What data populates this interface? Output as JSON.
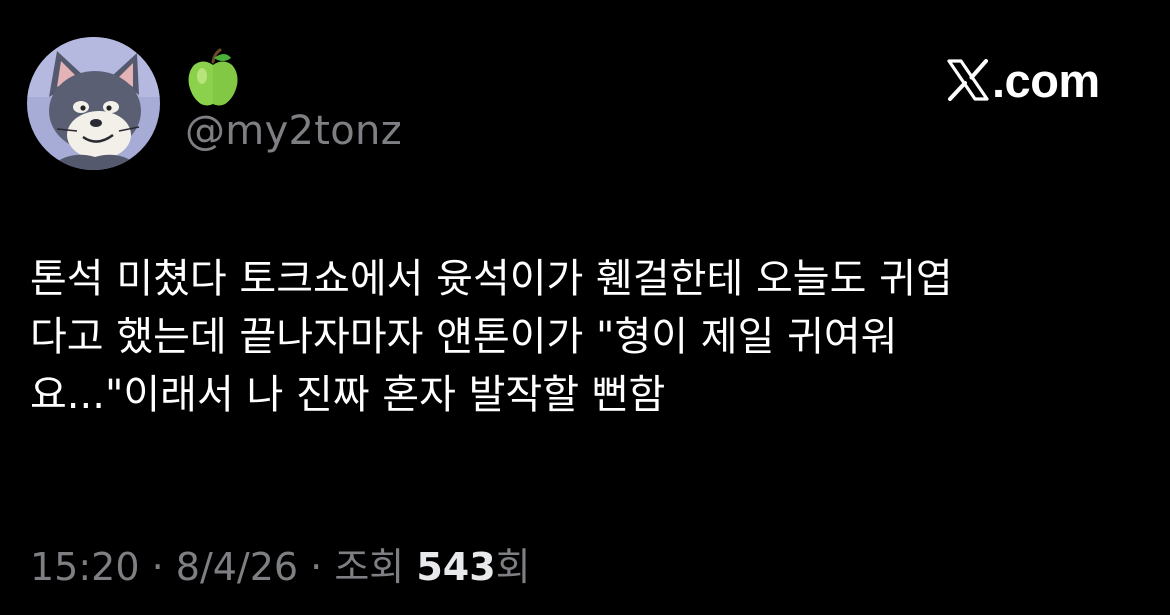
{
  "author": {
    "name_emoji": "🍏",
    "handle": "@my2tonz",
    "avatar_icon": "cartoon-cat-avatar-icon"
  },
  "brand": {
    "logo_icon": "x-logo-icon",
    "domain": ".com"
  },
  "tweet": {
    "lines": [
      "톤석 미쳤다 토크쇼에서 윳석이가 휀걸한테 오늘도 귀엽",
      "다고 했는데 끝나자마자 얜톤이가 \"형이 제일 귀여워",
      "요...\"이래서 나 진짜 혼자 발작할 뻔함"
    ]
  },
  "meta": {
    "time": "15:20",
    "sep1": " · ",
    "date": "8/4/26",
    "sep2": " · ",
    "views_prefix": "조회 ",
    "views_count": "543",
    "views_suffix": "회"
  },
  "colors": {
    "background": "#000000",
    "text": "#ffffff",
    "secondary": "#7d7f83"
  }
}
